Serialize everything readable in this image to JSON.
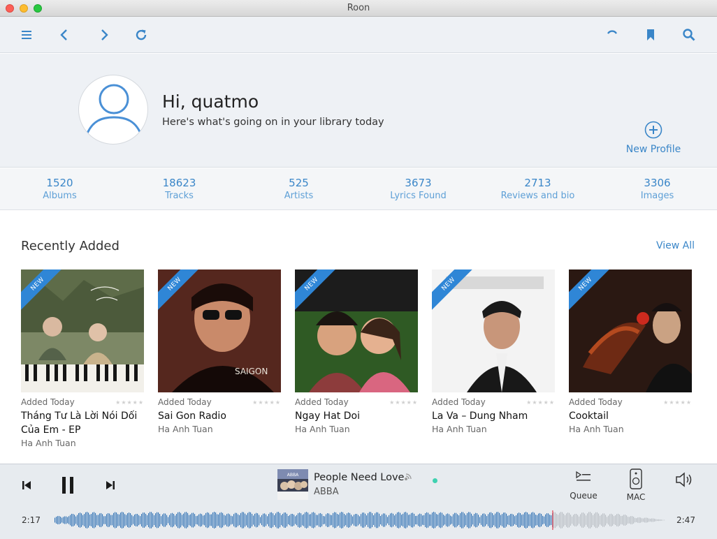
{
  "window": {
    "title": "Roon"
  },
  "profile": {
    "greeting": "Hi, quatmo",
    "subtitle": "Here's what's going on in your library today",
    "new_profile_label": "New Profile"
  },
  "stats": [
    {
      "value": "1520",
      "label": "Albums"
    },
    {
      "value": "18623",
      "label": "Tracks"
    },
    {
      "value": "525",
      "label": "Artists"
    },
    {
      "value": "3673",
      "label": "Lyrics Found"
    },
    {
      "value": "2713",
      "label": "Reviews and bio"
    },
    {
      "value": "3306",
      "label": "Images"
    }
  ],
  "recent": {
    "title": "Recently Added",
    "view_all": "View All",
    "albums": [
      {
        "ribbon": "NEW",
        "added": "Added Today",
        "title": "Tháng Tư Là Lời Nói Dối Của Em - EP",
        "artist": "Ha Anh Tuan",
        "cover_colors": [
          "#6f7a56",
          "#e9e6dc"
        ]
      },
      {
        "ribbon": "NEW",
        "added": "Added Today",
        "title": "Sai Gon Radio",
        "artist": "Ha Anh Tuan",
        "cover_colors": [
          "#5a2b22",
          "#1a0d0b"
        ]
      },
      {
        "ribbon": "NEW",
        "added": "Added Today",
        "title": "Ngay Hat Doi",
        "artist": "Ha Anh Tuan",
        "cover_colors": [
          "#3d6a2b",
          "#cf5f6a"
        ]
      },
      {
        "ribbon": "NEW",
        "added": "Added Today",
        "title": "La Va – Dung Nham",
        "artist": "Ha Anh Tuan",
        "cover_colors": [
          "#f2f2f2",
          "#1a1a1a"
        ]
      },
      {
        "ribbon": "NEW",
        "added": "Added Today",
        "title": "Cooktail",
        "artist": "Ha Anh Tuan",
        "cover_colors": [
          "#2c1a12",
          "#a33a1e"
        ]
      }
    ]
  },
  "player": {
    "track_title": "People Need Love",
    "track_artist": "ABBA",
    "queue_label": "Queue",
    "zone_label": "MAC",
    "elapsed": "2:17",
    "duration": "2:47",
    "progress": 0.815
  },
  "icons": {
    "menu": "menu-icon",
    "back": "chevron-left-icon",
    "forward": "chevron-right-icon",
    "refresh": "refresh-icon",
    "activity": "spinner-icon",
    "bookmark": "bookmark-icon",
    "search": "search-icon"
  },
  "colors": {
    "accent": "#3a86c8",
    "ribbon": "#2f86d6",
    "waveform_played": "#2c6fb3",
    "waveform_remaining": "#b7bcc2",
    "playhead": "#e2404f"
  }
}
